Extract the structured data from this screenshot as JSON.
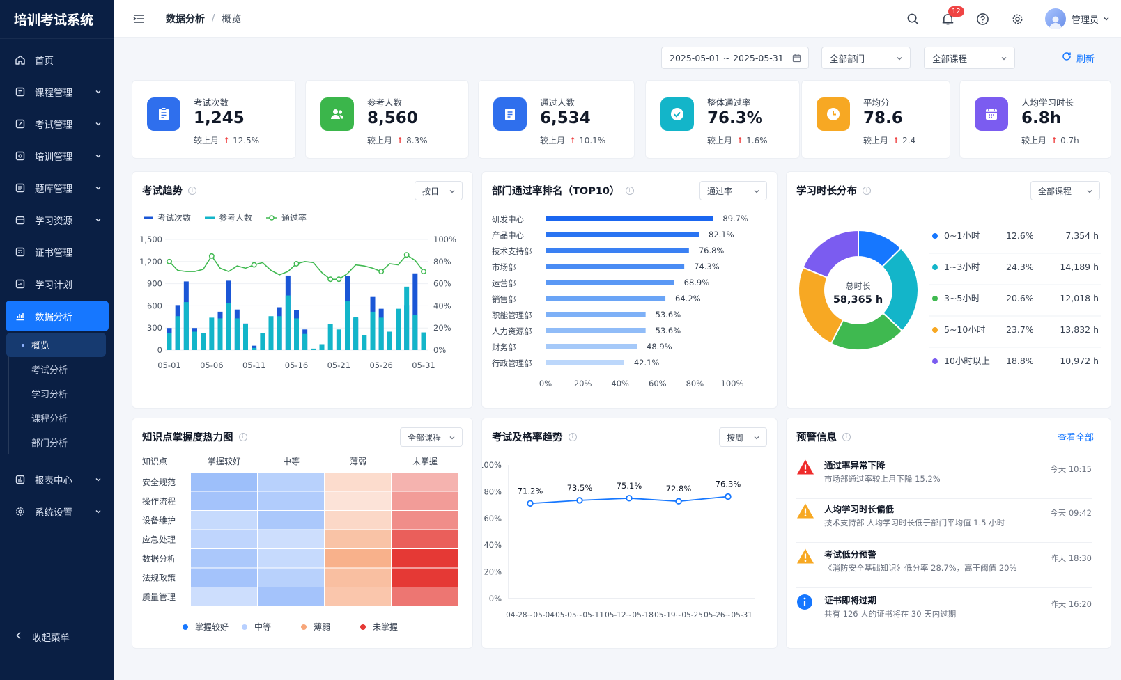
{
  "app": {
    "title": "培训考试系统"
  },
  "sidebar": {
    "items": [
      {
        "label": "首页",
        "icon": "home-icon"
      },
      {
        "label": "课程管理",
        "icon": "book-icon"
      },
      {
        "label": "考试管理",
        "icon": "edit-icon"
      },
      {
        "label": "培训管理",
        "icon": "clipboard-icon"
      },
      {
        "label": "题库管理",
        "icon": "question-bank-icon"
      },
      {
        "label": "学习资源",
        "icon": "folder-icon"
      },
      {
        "label": "证书管理",
        "icon": "certificate-icon"
      },
      {
        "label": "学习计划",
        "icon": "calendar-icon"
      },
      {
        "label": "数据分析",
        "icon": "chart-icon"
      }
    ],
    "subitems": [
      {
        "label": "概览"
      },
      {
        "label": "考试分析"
      },
      {
        "label": "学习分析"
      },
      {
        "label": "课程分析"
      },
      {
        "label": "部门分析"
      }
    ],
    "bottom_items": [
      {
        "label": "报表中心"
      },
      {
        "label": "系统设置"
      }
    ],
    "collapse_label": "收起菜单"
  },
  "header": {
    "breadcrumb": "数据分析",
    "breadcrumb_sep": "/",
    "page": "概览",
    "notification_count": "12",
    "user": "管理员"
  },
  "filters": {
    "date_range": "2025-05-01 ~ 2025-05-31",
    "department": "全部部门",
    "course": "全部课程",
    "refresh": "刷新"
  },
  "kpis": [
    {
      "label": "考试次数",
      "value": "1,245",
      "compare": "较上月",
      "delta": "12.5%",
      "color": "#2f6fed",
      "icon": "document-icon"
    },
    {
      "label": "参考人数",
      "value": "8,560",
      "compare": "较上月",
      "delta": "8.3%",
      "color": "#3bb64b",
      "icon": "users-icon"
    },
    {
      "label": "通过人数",
      "value": "6,534",
      "compare": "较上月",
      "delta": "10.1%",
      "color": "#2f6fed",
      "icon": "file-check-icon"
    },
    {
      "label": "整体通过率",
      "value": "76.3%",
      "compare": "较上月",
      "delta": "1.6%",
      "color": "#13b5c9",
      "icon": "check-circle-icon"
    },
    {
      "label": "平均分",
      "value": "78.6",
      "compare": "较上月",
      "delta": "2.4",
      "color": "#f7a823",
      "icon": "clock-icon"
    },
    {
      "label": "人均学习时长",
      "value": "6.8h",
      "compare": "较上月",
      "delta": "0.7h",
      "color": "#7b5cf0",
      "icon": "calendar-icon"
    }
  ],
  "exam_trend": {
    "title": "考试趋势",
    "select": "按日",
    "legend": [
      "考试次数",
      "参考人数",
      "通过率"
    ],
    "y_left_ticks": [
      "0",
      "300",
      "600",
      "900",
      "1,200",
      "1,500"
    ],
    "y_right_ticks": [
      "0%",
      "20%",
      "40%",
      "60%",
      "80%",
      "100%"
    ],
    "x_ticks": [
      "05-01",
      "05-06",
      "05-11",
      "05-16",
      "05-21",
      "05-26",
      "05-31"
    ]
  },
  "dept_rank": {
    "title": "部门通过率排名（TOP10）",
    "select": "通过率",
    "x_ticks": [
      "0%",
      "20%",
      "40%",
      "60%",
      "80%",
      "100%"
    ]
  },
  "study_dist": {
    "title": "学习时长分布",
    "select": "全部课程",
    "center_label": "总时长",
    "center_value": "58,365 h"
  },
  "heatmap": {
    "title": "知识点掌握度热力图",
    "select": "全部课程",
    "corner": "知识点"
  },
  "pass_trend": {
    "title": "考试及格率趋势",
    "select": "按周",
    "y_ticks": [
      "0%",
      "20%",
      "40%",
      "60%",
      "80%",
      "100%"
    ]
  },
  "alerts": {
    "title": "预警信息",
    "view_all": "查看全部",
    "items": [
      {
        "title": "通过率异常下降",
        "desc": "市场部通过率较上月下降 15.2%",
        "time": "今天 10:15",
        "level": "error"
      },
      {
        "title": "人均学习时长偏低",
        "desc": "技术支持部 人均学习时长低于部门平均值 1.5 小时",
        "time": "今天 09:42",
        "level": "warning"
      },
      {
        "title": "考试低分预警",
        "desc": "《消防安全基础知识》低分率 28.7%，高于阈值 20%",
        "time": "昨天 18:30",
        "level": "warning"
      },
      {
        "title": "证书即将过期",
        "desc": "共有 126 人的证书将在 30 天内过期",
        "time": "昨天 16:20",
        "level": "info"
      }
    ]
  },
  "chart_data": [
    {
      "type": "bar",
      "title": "考试趋势",
      "categories": [
        "05-01",
        "05-02",
        "05-03",
        "05-04",
        "05-05",
        "05-06",
        "05-07",
        "05-08",
        "05-09",
        "05-10",
        "05-11",
        "05-12",
        "05-13",
        "05-14",
        "05-15",
        "05-16",
        "05-17",
        "05-18",
        "05-19",
        "05-20",
        "05-21",
        "05-22",
        "05-23",
        "05-24",
        "05-25",
        "05-26",
        "05-27",
        "05-28",
        "05-29",
        "05-30",
        "05-31"
      ],
      "series": [
        {
          "name": "考试次数",
          "axis": "left",
          "values": [
            300,
            610,
            930,
            300,
            0,
            0,
            520,
            940,
            550,
            360,
            60,
            0,
            0,
            580,
            1010,
            540,
            280,
            0,
            80,
            0,
            0,
            1000,
            430,
            0,
            720,
            560,
            0,
            0,
            610,
            1040,
            0
          ],
          "color": "#1a56d6"
        },
        {
          "name": "参考人数",
          "axis": "left",
          "values": [
            230,
            460,
            650,
            250,
            230,
            440,
            430,
            640,
            430,
            350,
            30,
            230,
            460,
            460,
            740,
            430,
            220,
            20,
            80,
            350,
            280,
            660,
            450,
            200,
            520,
            440,
            250,
            560,
            860,
            480,
            240
          ],
          "color": "#13b5c9"
        },
        {
          "name": "通过率",
          "type": "line",
          "axis": "right",
          "values": [
            80,
            72,
            71,
            71,
            73,
            85,
            74,
            71,
            76,
            74,
            77,
            79,
            72,
            68,
            71,
            78,
            80,
            79,
            70,
            64,
            64,
            69,
            77,
            76,
            74,
            71,
            78,
            77,
            86,
            81,
            71
          ],
          "color": "#3fb950"
        }
      ],
      "ylim_left": [
        0,
        1500
      ],
      "ylim_right": [
        0,
        100
      ]
    },
    {
      "type": "bar",
      "title": "部门通过率排名（TOP10）",
      "orientation": "horizontal",
      "categories": [
        "研发中心",
        "产品中心",
        "技术支持部",
        "市场部",
        "运营部",
        "销售部",
        "职能管理部",
        "人力资源部",
        "财务部",
        "行政管理部"
      ],
      "values": [
        89.7,
        82.1,
        76.8,
        74.3,
        68.9,
        64.2,
        53.6,
        53.6,
        48.9,
        42.1
      ],
      "labels": [
        "89.7%",
        "82.1%",
        "76.8%",
        "74.3%",
        "68.9%",
        "64.2%",
        "53.6%",
        "53.6%",
        "48.9%",
        "42.1%"
      ],
      "xlim": [
        0,
        100
      ]
    },
    {
      "type": "pie",
      "title": "学习时长分布",
      "categories": [
        "0~1小时",
        "1~3小时",
        "3~5小时",
        "5~10小时",
        "10小时以上"
      ],
      "values": [
        12.6,
        24.3,
        20.6,
        23.7,
        18.8
      ],
      "percent_labels": [
        "12.6%",
        "24.3%",
        "20.6%",
        "23.7%",
        "18.8%"
      ],
      "hours": [
        "7,354 h",
        "14,189 h",
        "12,018 h",
        "13,832 h",
        "10,972 h"
      ],
      "colors": [
        "#1677ff",
        "#13b5c9",
        "#3fb950",
        "#f7a823",
        "#7b5cf0"
      ]
    },
    {
      "type": "heatmap",
      "title": "知识点掌握度热力图",
      "columns": [
        "掌握较好",
        "中等",
        "薄弱",
        "未掌握"
      ],
      "rows": [
        "安全规范",
        "操作流程",
        "设备维护",
        "应急处理",
        "数据分析",
        "法规政策",
        "质量管理"
      ],
      "values": [
        [
          0.55,
          0.35,
          0.25,
          0.2
        ],
        [
          0.5,
          0.4,
          0.15,
          0.35
        ],
        [
          0.25,
          0.45,
          0.3,
          0.45
        ],
        [
          0.3,
          0.2,
          0.6,
          0.75
        ],
        [
          0.45,
          0.25,
          0.85,
          1.0
        ],
        [
          0.5,
          0.35,
          0.65,
          1.0
        ],
        [
          0.2,
          0.5,
          0.55,
          0.6
        ]
      ],
      "legend": [
        "掌握较好",
        "中等",
        "薄弱",
        "未掌握"
      ],
      "colors": [
        "#1677ff",
        "#b8d0ff",
        "#f7a67a",
        "#e53935"
      ]
    },
    {
      "type": "line",
      "title": "考试及格率趋势",
      "x": [
        "04-28~05-04",
        "05-05~05-11",
        "05-12~05-18",
        "05-19~05-25",
        "05-26~05-31"
      ],
      "values": [
        71.2,
        73.5,
        75.1,
        72.8,
        76.3
      ],
      "labels": [
        "71.2%",
        "73.5%",
        "75.1%",
        "72.8%",
        "76.3%"
      ],
      "ylim": [
        0,
        100
      ]
    }
  ]
}
